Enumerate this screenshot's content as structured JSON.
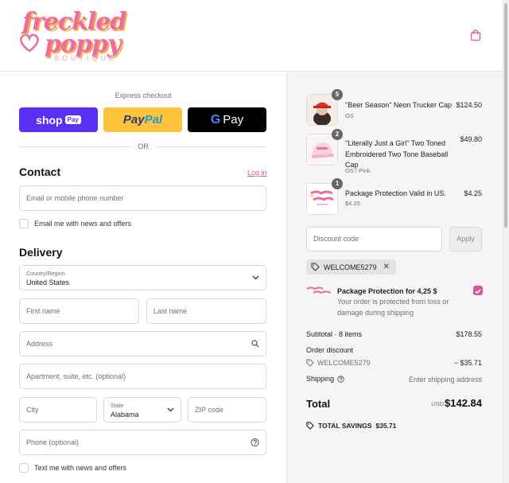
{
  "header": {
    "logo": {
      "line1": "freckled",
      "line2": "poppy",
      "line3": "BOUTIQUE"
    },
    "cart_icon": "shopping-bag-icon"
  },
  "express": {
    "title": "Express checkout",
    "shop": {
      "label": "shop",
      "pay": "Pay"
    },
    "paypal": {
      "part1": "Pay",
      "part2": "Pal"
    },
    "gpay": {
      "g": "G",
      "label": "Pay"
    },
    "or": "OR"
  },
  "contact": {
    "title": "Contact",
    "login": "Log in",
    "email_placeholder": "Email or mobile phone number",
    "email_news": "Email me with news and offers"
  },
  "delivery": {
    "title": "Delivery",
    "country_label": "Country/Region",
    "country_value": "United States",
    "first_name": "First name",
    "last_name": "Last name",
    "address": "Address",
    "apartment": "Apartment, suite, etc. (optional)",
    "city": "City",
    "state_label": "State",
    "state_value": "Alabama",
    "zip": "ZIP code",
    "phone": "Phone (optional)",
    "text_news": "Text me with news and offers"
  },
  "cart": {
    "items": [
      {
        "qty": "5",
        "name": "\"Beer Season\" Neon Trucker Cap",
        "sub": "OS",
        "price": "$124.50"
      },
      {
        "qty": "2",
        "name": "\"Literally Just a Girl\" Two Toned Embroidered Two Tone Baseball Cap",
        "sub": "OS / Pink",
        "price": "$49.80"
      },
      {
        "qty": "1",
        "name": "Package Protection Valid in US.",
        "sub": "$4.25",
        "price": "$4.25"
      }
    ],
    "discount_placeholder": "Discount code",
    "apply": "Apply",
    "code": "WELCOME5279",
    "protection": {
      "title": "Package Protection for 4,25 $",
      "desc": "Your order is protected from loss or damage during shipping"
    },
    "subtotal_label": "Subtotal · 8 items",
    "subtotal_value": "$178.55",
    "order_discount_label": "Order discount",
    "discount_code": "WELCOME5279",
    "discount_value": "− $35.71",
    "shipping_label": "Shipping",
    "shipping_value": "Enter shipping address",
    "total_label": "Total",
    "currency": "USD",
    "total_value": "$142.84",
    "savings_label": "TOTAL SAVINGS",
    "savings_value": "$35.71"
  },
  "colors": {
    "accent": "#d6569c",
    "shop": "#5a31f4",
    "paypal": "#ffc439"
  }
}
